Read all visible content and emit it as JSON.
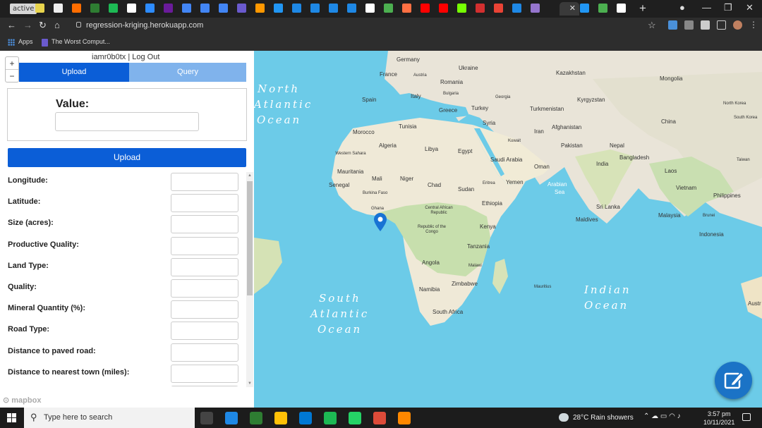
{
  "browser": {
    "active_tab_pill": "active",
    "current_tab_close": "✕",
    "new_tab": "+",
    "url": "regression-kriging.herokuapp.com",
    "bookmarks": [
      {
        "label": "Apps",
        "icon": "apps-grid-icon"
      },
      {
        "label": "The Worst Comput...",
        "icon": "bookmark-page-icon"
      }
    ],
    "favicon_colors": [
      "#e8d44d",
      "#eeeeee",
      "#ff6d00",
      "#2e7d32",
      "#1db954",
      "#ffffff",
      "#2d8cff",
      "#6a1b9a",
      "#4285f4",
      "#4285f4",
      "#4285f4",
      "#6a5acd",
      "#ff9800",
      "#2196f3",
      "#1e88e5",
      "#1e88e5",
      "#1e88e5",
      "#1e88e5",
      "#ffffff",
      "#4caf50",
      "#ff7043",
      "#ff0000",
      "#ff0000",
      "#76ff03",
      "#d32f2f",
      "#ea4335",
      "#1e88e5",
      "#9575cd"
    ],
    "right_favicon_colors": [
      "#2196f3",
      "#4caf50",
      "#ffffff"
    ]
  },
  "panel": {
    "zoom_in": "+",
    "zoom_out": "−",
    "user_line": "iamr0b0tx | Log Out",
    "tab_upload": "Upload",
    "tab_query": "Query",
    "value_label": "Value:",
    "upload_button": "Upload",
    "fields": [
      {
        "label": "Longitude:"
      },
      {
        "label": "Latitude:"
      },
      {
        "label": "Size (acres):"
      },
      {
        "label": "Productive Quality:"
      },
      {
        "label": "Land Type:"
      },
      {
        "label": "Quality:"
      },
      {
        "label": "Mineral Quantity (%):"
      },
      {
        "label": "Road Type:"
      },
      {
        "label": "Distance to paved road:"
      },
      {
        "label": "Distance to nearest town (miles):"
      }
    ],
    "mapbox_logo": "mapbox"
  },
  "map": {
    "colors": {
      "water": "#6ccbe8",
      "land": "#eae6dc",
      "forest": "#c7dfb0",
      "desert": "#f2ecd9",
      "marker": "#1873d4",
      "edit_button": "#1b73c6"
    },
    "ocean_labels": [
      "North",
      "Atlantic",
      "Ocean",
      "South",
      "Atlantic",
      "Ocean",
      "Indian",
      "Ocean",
      "Arabian",
      "Sea"
    ],
    "country_labels": [
      "Germany",
      "Ukraine",
      "Kazakhstan",
      "Mongolia",
      "France",
      "Austria",
      "Romania",
      "Spain",
      "Italy",
      "Bulgaria",
      "Georgia",
      "Kyrgyzstan",
      "North Korea",
      "Greece",
      "Turkey",
      "Turkmenistan",
      "South Korea",
      "China",
      "Tunisia",
      "Syria",
      "Afghanistan",
      "Morocco",
      "Iran",
      "Kuwait",
      "Pakistan",
      "Nepal",
      "Algeria",
      "Libya",
      "Egypt",
      "Western Sahara",
      "Saudi Arabia",
      "Oman",
      "India",
      "Bangladesh",
      "Taiwan",
      "Mauritania",
      "Laos",
      "Mali",
      "Niger",
      "Chad",
      "Sudan",
      "Eritrea",
      "Yemen",
      "Senegal",
      "Vietnam",
      "Philippines",
      "Burkina Faso",
      "Ethiopia",
      "Sri Lanka",
      "Ghana",
      "Central African Republic",
      "Malaysia",
      "Brunei",
      "Maldives",
      "Republic of the Congo",
      "Kenya",
      "Indonesia",
      "Tanzania",
      "Angola",
      "Malawi",
      "Zimbabwe",
      "Namibia",
      "Mauritius",
      "South Africa",
      "Austr"
    ]
  },
  "taskbar": {
    "search_placeholder": "Type here to search",
    "weather": "28°C Rain showers",
    "time": "3:57 pm",
    "date": "10/11/2021",
    "app_colors": [
      "#444444",
      "#1e88e5",
      "#2e7d32",
      "#ffc107",
      "#0078d4",
      "#1db954",
      "#25d366",
      "#dd4b39",
      "#ff8800"
    ]
  }
}
